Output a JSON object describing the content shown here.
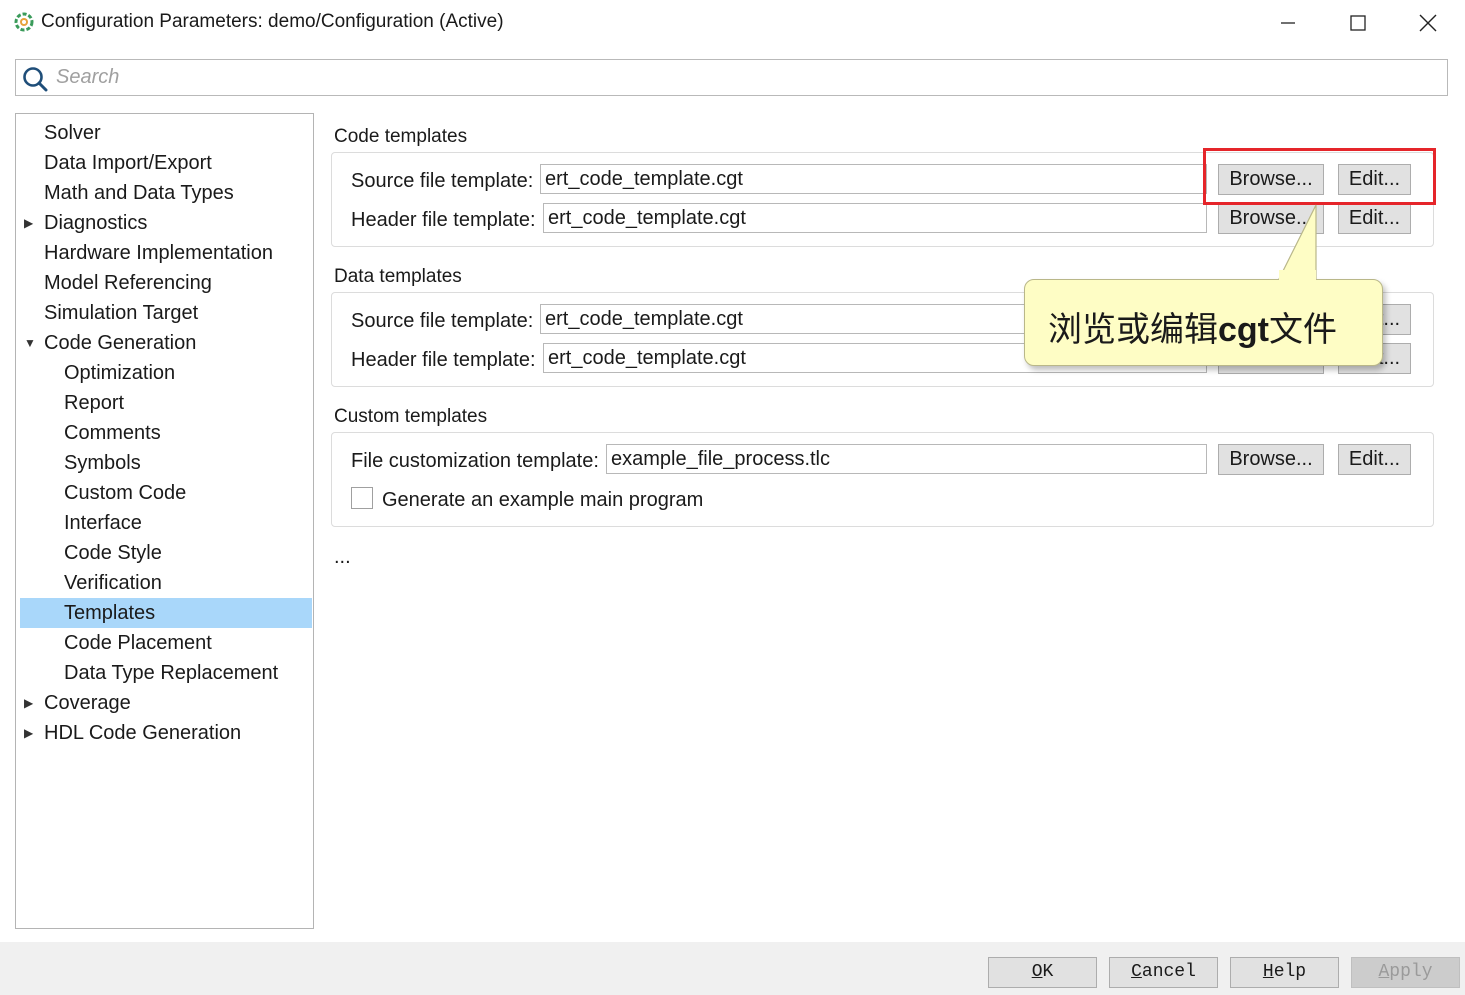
{
  "window": {
    "title": "Configuration Parameters: demo/Configuration (Active)"
  },
  "search": {
    "placeholder": "Search",
    "value": ""
  },
  "tree": {
    "items": [
      {
        "label": "Solver",
        "level": 0,
        "expander": ""
      },
      {
        "label": "Data Import/Export",
        "level": 0,
        "expander": ""
      },
      {
        "label": "Math and Data Types",
        "level": 0,
        "expander": ""
      },
      {
        "label": "Diagnostics",
        "level": 0,
        "expander": "▶"
      },
      {
        "label": "Hardware Implementation",
        "level": 0,
        "expander": ""
      },
      {
        "label": "Model Referencing",
        "level": 0,
        "expander": ""
      },
      {
        "label": "Simulation Target",
        "level": 0,
        "expander": ""
      },
      {
        "label": "Code Generation",
        "level": 0,
        "expander": "▼"
      },
      {
        "label": "Optimization",
        "level": 1,
        "expander": ""
      },
      {
        "label": "Report",
        "level": 1,
        "expander": ""
      },
      {
        "label": "Comments",
        "level": 1,
        "expander": ""
      },
      {
        "label": "Symbols",
        "level": 1,
        "expander": ""
      },
      {
        "label": "Custom Code",
        "level": 1,
        "expander": ""
      },
      {
        "label": "Interface",
        "level": 1,
        "expander": ""
      },
      {
        "label": "Code Style",
        "level": 1,
        "expander": ""
      },
      {
        "label": "Verification",
        "level": 1,
        "expander": ""
      },
      {
        "label": "Templates",
        "level": 1,
        "expander": "",
        "selected": true
      },
      {
        "label": "Code Placement",
        "level": 1,
        "expander": ""
      },
      {
        "label": "Data Type Replacement",
        "level": 1,
        "expander": ""
      },
      {
        "label": "Coverage",
        "level": 0,
        "expander": "▶"
      },
      {
        "label": "HDL Code Generation",
        "level": 0,
        "expander": "▶"
      }
    ]
  },
  "code_templates": {
    "title": "Code templates",
    "source_label": "Source file template:",
    "source_value": "ert_code_template.cgt",
    "header_label": "Header file template:",
    "header_value": "ert_code_template.cgt",
    "browse_label": "Browse...",
    "edit_label": "Edit..."
  },
  "data_templates": {
    "title": "Data templates",
    "source_label": "Source file template:",
    "source_value": "ert_code_template.cgt",
    "header_label": "Header file template:",
    "header_value": "ert_code_template.cgt",
    "browse_label": "Browse...",
    "edit_label": "Edit..."
  },
  "custom_templates": {
    "title": "Custom templates",
    "file_label": "File customization template:",
    "file_value": "example_file_process.tlc",
    "browse_label": "Browse...",
    "edit_label": "Edit...",
    "checkbox_label": "Generate an example main program",
    "checkbox_checked": false
  },
  "ellipsis": "...",
  "callout": {
    "text": "浏览或编辑cgt文件",
    "bold_part": "cgt",
    "highlight_color": "#e5252a",
    "bubble_color": "#fefdc5"
  },
  "footer": {
    "ok": {
      "mnemonic": "O",
      "rest": "K"
    },
    "cancel": {
      "mnemonic": "C",
      "rest": "ancel"
    },
    "help": {
      "mnemonic": "H",
      "rest": "elp"
    },
    "apply": {
      "mnemonic": "A",
      "rest": "pply",
      "disabled": true
    }
  },
  "colors": {
    "selection": "#a9d7fa",
    "icon": "#2e8b57"
  }
}
